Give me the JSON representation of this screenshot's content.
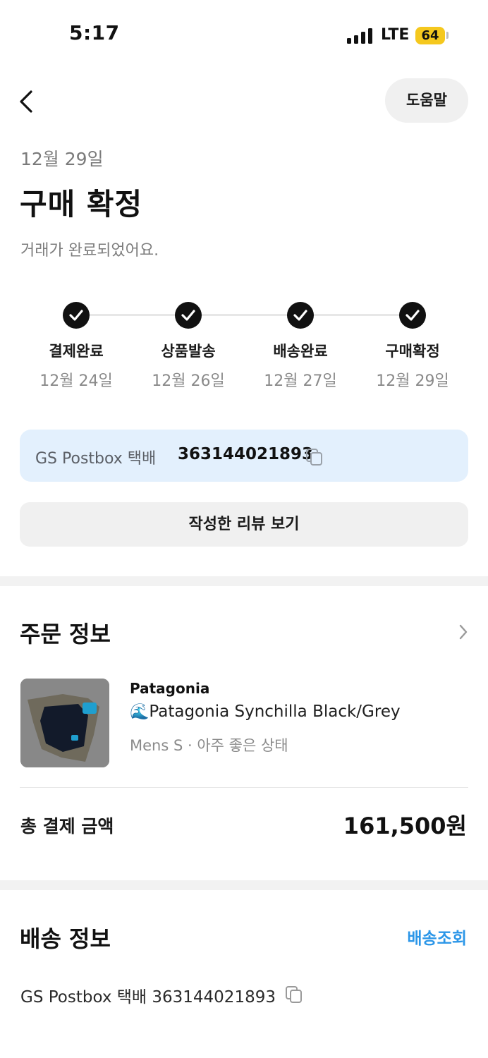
{
  "status_bar": {
    "time": "5:17",
    "network": "LTE",
    "battery": "64"
  },
  "header": {
    "back_icon": "chevron-left-icon",
    "help_label": "도움말"
  },
  "order_status": {
    "date": "12월 29일",
    "title": "구매 확정",
    "subtitle": "거래가 완료되었어요."
  },
  "steps": [
    {
      "label": "결제완료",
      "date": "12월 24일"
    },
    {
      "label": "상품발송",
      "date": "12월 26일"
    },
    {
      "label": "배송완료",
      "date": "12월 27일"
    },
    {
      "label": "구매확정",
      "date": "12월 29일"
    }
  ],
  "tracking": {
    "carrier": "GS Postbox 택배",
    "number": "363144021893"
  },
  "review_button_label": "작성한 리뷰 보기",
  "order_info": {
    "title": "주문 정보",
    "product": {
      "brand": "Patagonia",
      "emoji": "🌊",
      "name": "Patagonia Synchilla Black/Grey",
      "meta": "Mens S · 아주 좋은 상태"
    },
    "total_label": "총 결제 금액",
    "total_value": "161,500원"
  },
  "shipping_info": {
    "title": "배송 정보",
    "track_link": "배송조회",
    "line": "GS Postbox 택배 363144021893"
  },
  "colors": {
    "accent_blue": "#2b96e8",
    "tracking_bg": "#e3f0fd",
    "battery": "#f5c81e"
  }
}
